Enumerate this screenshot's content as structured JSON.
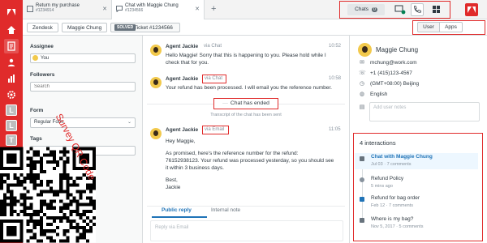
{
  "tabs": [
    {
      "title": "Return my purchase",
      "subtitle": "#1234914"
    },
    {
      "title": "Chat with Maggie Chung",
      "subtitle": "#1234566"
    }
  ],
  "tab_add": "+",
  "top_right": {
    "chats_label": "Chats",
    "chats_count": "0"
  },
  "breadcrumb": {
    "org": "Zendesk",
    "user": "Maggie Chung",
    "status": "SOLVED",
    "ticket": "Ticket #1234566"
  },
  "panel_toggle": {
    "user": "User",
    "apps": "Apps"
  },
  "form": {
    "assignee_label": "Assignee",
    "assignee_value": "You",
    "followers_label": "Followers",
    "followers_placeholder": "Search",
    "form_label": "Form",
    "form_value": "Regular Form",
    "tags_label": "Tags"
  },
  "overlay": {
    "survey": "Survey QR Code"
  },
  "messages": [
    {
      "agent": "Agent Jackie",
      "via": "via Chat",
      "time": "10:52",
      "lines": [
        "Hello Maggie! Sorry that this is happening to you. Please hold while I",
        "check that for you."
      ]
    },
    {
      "agent": "Agent Jackie",
      "via": "via Chat",
      "time": "10:58",
      "lines": [
        "Your refund has been processed. I will email you the reference number."
      ]
    },
    {
      "agent": "Agent Jackie",
      "via": "via Email",
      "time": "11:05",
      "lines": [
        "Hey Maggie,",
        "",
        "As promised, here's the reference number for the refund:",
        "76152938123. Your refund was processed yesterday, so you should see",
        "it within 3 business days.",
        "",
        "Best,",
        "Jackie"
      ]
    }
  ],
  "chat_ended": "Chat has ended",
  "transcript_note": "Transcript of the chat has been sent",
  "composer": {
    "tab_public": "Public reply",
    "tab_internal": "Internal note",
    "placeholder": "Reply via Email"
  },
  "user": {
    "name": "Maggie Chung",
    "email": "mchung@work.com",
    "phone": "+1 (415)123-4567",
    "timezone": "(GMT+08:00) Beijing",
    "language": "English",
    "notes_placeholder": "Add user notes"
  },
  "interactions": {
    "title": "4 interactions",
    "items": [
      {
        "title": "Chat with Maggie Chung",
        "sub": "Jul 03 · 7 comments",
        "color": "#68737d",
        "bold": true
      },
      {
        "title": "Refund Policy",
        "sub": "5 mins ago",
        "color": "#87929d",
        "bold": false
      },
      {
        "title": "Refund for bag order",
        "sub": "Feb 12 · 7 comments",
        "color": "#1f73b7",
        "bold": false
      },
      {
        "title": "Where is my bag?",
        "sub": "Nov 5, 2017 · 5 comments",
        "color": "#68737d",
        "bold": false
      }
    ]
  },
  "colors": {
    "brand": "#e02b2b",
    "link": "#1f73b7",
    "annotation": "#e02b2b"
  }
}
